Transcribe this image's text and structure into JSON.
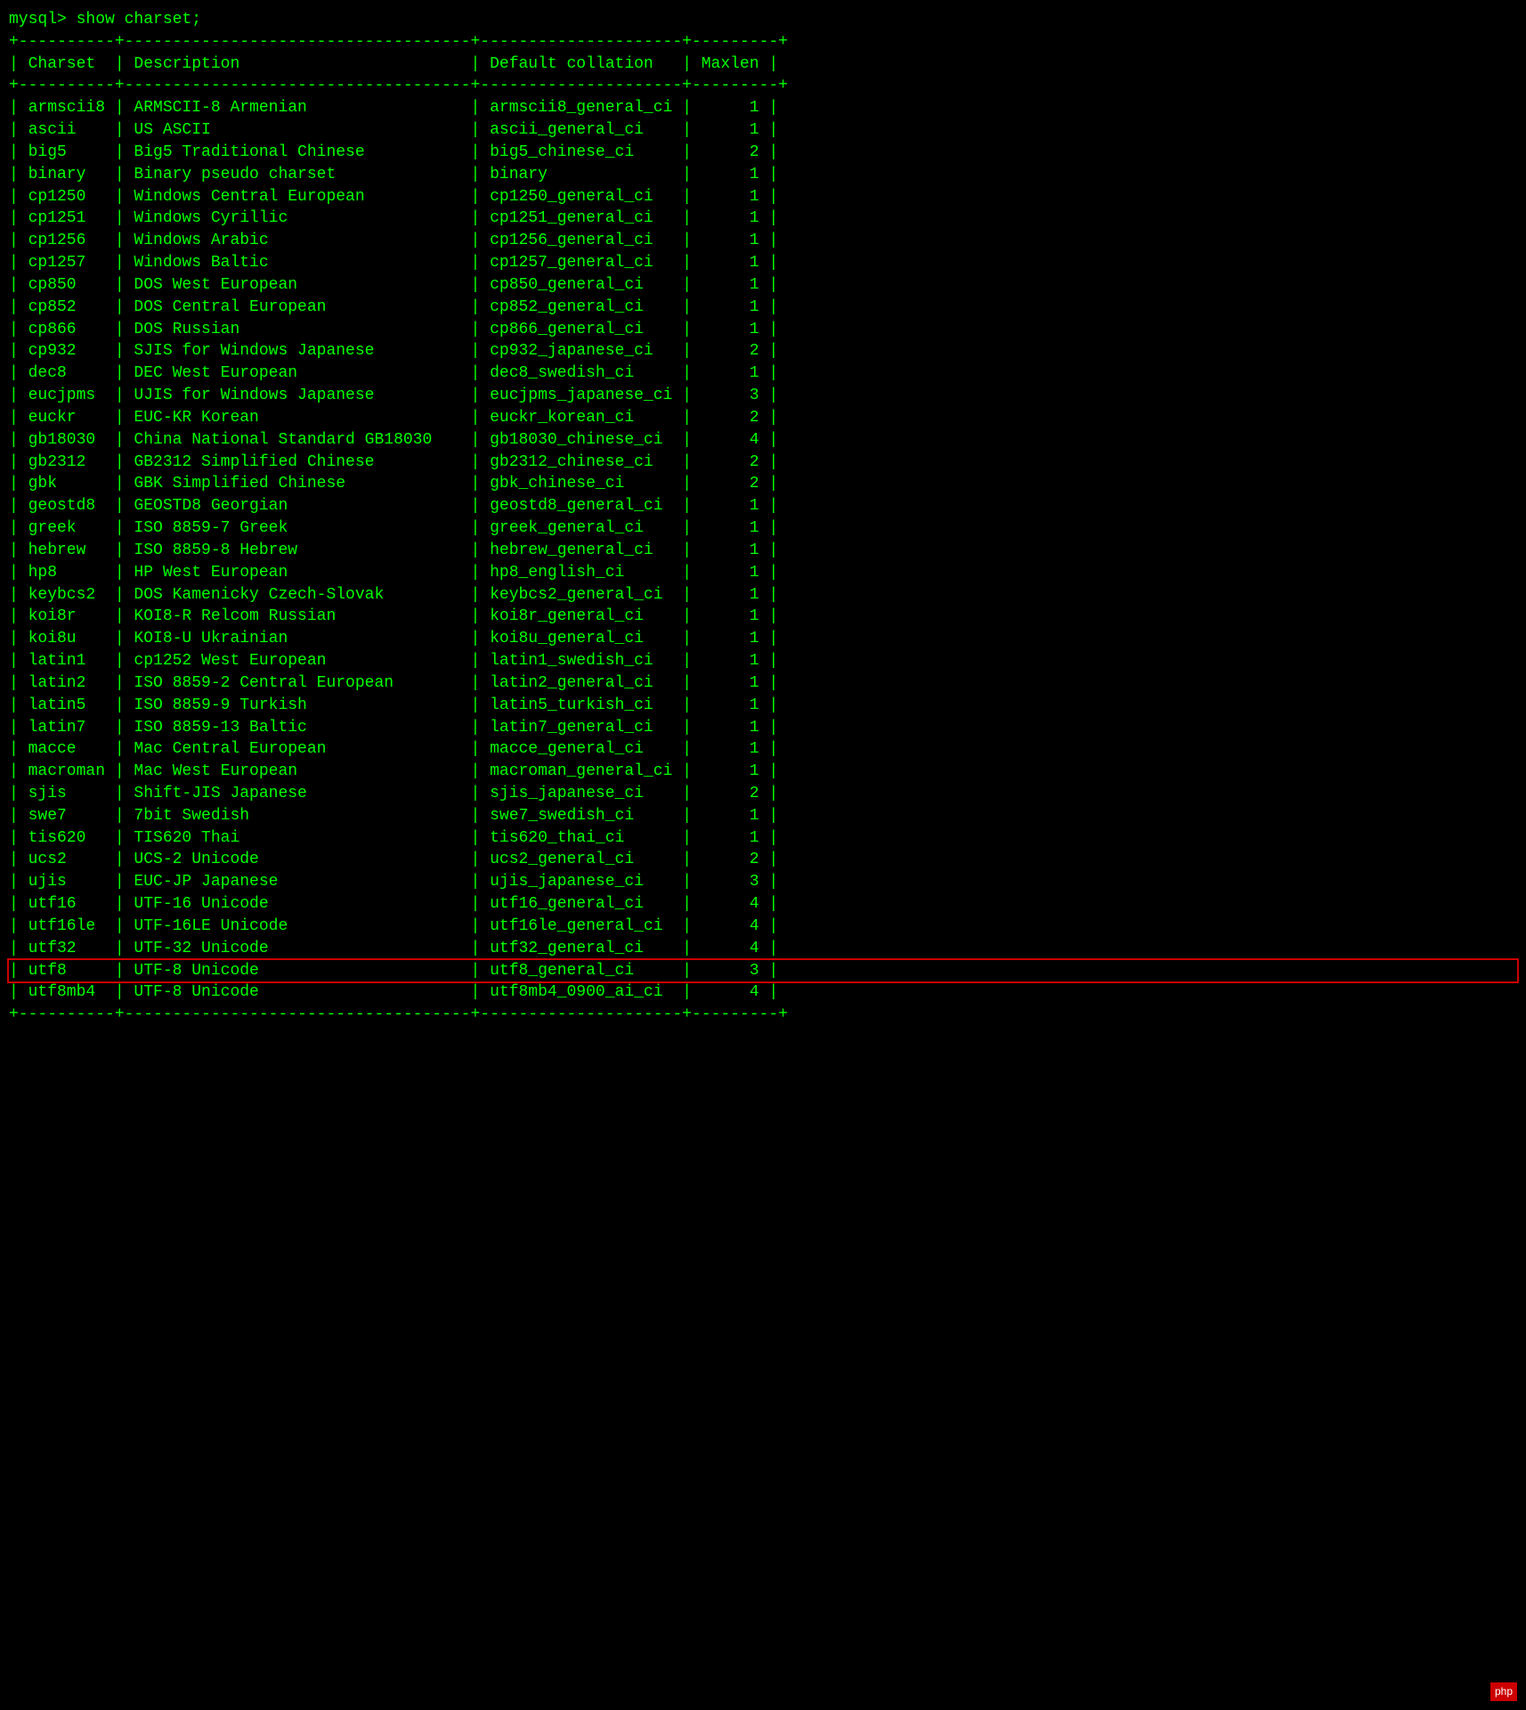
{
  "terminal": {
    "command": "mysql> show charset;",
    "separator_top": "+----------+------------------------------------+---------------------+---------+",
    "separator_head": "+----------+------------------------------------+---------------------+---------+",
    "separator_row": "+----------+------------------------------------+---------------------+---------+",
    "header": {
      "charset": "Charset",
      "description": "Description",
      "collation": "Default collation",
      "maxlen": "Maxlen"
    },
    "rows": [
      {
        "charset": "armscii8",
        "description": "ARMSCII-8 Armenian",
        "collation": "armscii8_general_ci",
        "maxlen": "1"
      },
      {
        "charset": "ascii",
        "description": "US ASCII",
        "collation": "ascii_general_ci",
        "maxlen": "1"
      },
      {
        "charset": "big5",
        "description": "Big5 Traditional Chinese",
        "collation": "big5_chinese_ci",
        "maxlen": "2"
      },
      {
        "charset": "binary",
        "description": "Binary pseudo charset",
        "collation": "binary",
        "maxlen": "1"
      },
      {
        "charset": "cp1250",
        "description": "Windows Central European",
        "collation": "cp1250_general_ci",
        "maxlen": "1"
      },
      {
        "charset": "cp1251",
        "description": "Windows Cyrillic",
        "collation": "cp1251_general_ci",
        "maxlen": "1"
      },
      {
        "charset": "cp1256",
        "description": "Windows Arabic",
        "collation": "cp1256_general_ci",
        "maxlen": "1"
      },
      {
        "charset": "cp1257",
        "description": "Windows Baltic",
        "collation": "cp1257_general_ci",
        "maxlen": "1"
      },
      {
        "charset": "cp850",
        "description": "DOS West European",
        "collation": "cp850_general_ci",
        "maxlen": "1"
      },
      {
        "charset": "cp852",
        "description": "DOS Central European",
        "collation": "cp852_general_ci",
        "maxlen": "1"
      },
      {
        "charset": "cp866",
        "description": "DOS Russian",
        "collation": "cp866_general_ci",
        "maxlen": "1"
      },
      {
        "charset": "cp932",
        "description": "SJIS for Windows Japanese",
        "collation": "cp932_japanese_ci",
        "maxlen": "2"
      },
      {
        "charset": "dec8",
        "description": "DEC West European",
        "collation": "dec8_swedish_ci",
        "maxlen": "1"
      },
      {
        "charset": "eucjpms",
        "description": "UJIS for Windows Japanese",
        "collation": "eucjpms_japanese_ci",
        "maxlen": "3"
      },
      {
        "charset": "euckr",
        "description": "EUC-KR Korean",
        "collation": "euckr_korean_ci",
        "maxlen": "2"
      },
      {
        "charset": "gb18030",
        "description": "China National Standard GB18030",
        "collation": "gb18030_chinese_ci",
        "maxlen": "4"
      },
      {
        "charset": "gb2312",
        "description": "GB2312 Simplified Chinese",
        "collation": "gb2312_chinese_ci",
        "maxlen": "2"
      },
      {
        "charset": "gbk",
        "description": "GBK Simplified Chinese",
        "collation": "gbk_chinese_ci",
        "maxlen": "2"
      },
      {
        "charset": "geostd8",
        "description": "GEOSTD8 Georgian",
        "collation": "geostd8_general_ci",
        "maxlen": "1"
      },
      {
        "charset": "greek",
        "description": "ISO 8859-7 Greek",
        "collation": "greek_general_ci",
        "maxlen": "1"
      },
      {
        "charset": "hebrew",
        "description": "ISO 8859-8 Hebrew",
        "collation": "hebrew_general_ci",
        "maxlen": "1"
      },
      {
        "charset": "hp8",
        "description": "HP West European",
        "collation": "hp8_english_ci",
        "maxlen": "1"
      },
      {
        "charset": "keybcs2",
        "description": "DOS Kamenicky Czech-Slovak",
        "collation": "keybcs2_general_ci",
        "maxlen": "1"
      },
      {
        "charset": "koi8r",
        "description": "KOI8-R Relcom Russian",
        "collation": "koi8r_general_ci",
        "maxlen": "1"
      },
      {
        "charset": "koi8u",
        "description": "KOI8-U Ukrainian",
        "collation": "koi8u_general_ci",
        "maxlen": "1"
      },
      {
        "charset": "latin1",
        "description": "cp1252 West European",
        "collation": "latin1_swedish_ci",
        "maxlen": "1"
      },
      {
        "charset": "latin2",
        "description": "ISO 8859-2 Central European",
        "collation": "latin2_general_ci",
        "maxlen": "1"
      },
      {
        "charset": "latin5",
        "description": "ISO 8859-9 Turkish",
        "collation": "latin5_turkish_ci",
        "maxlen": "1"
      },
      {
        "charset": "latin7",
        "description": "ISO 8859-13 Baltic",
        "collation": "latin7_general_ci",
        "maxlen": "1"
      },
      {
        "charset": "macce",
        "description": "Mac Central European",
        "collation": "macce_general_ci",
        "maxlen": "1"
      },
      {
        "charset": "macroman",
        "description": "Mac West European",
        "collation": "macroman_general_ci",
        "maxlen": "1"
      },
      {
        "charset": "sjis",
        "description": "Shift-JIS Japanese",
        "collation": "sjis_japanese_ci",
        "maxlen": "2"
      },
      {
        "charset": "swe7",
        "description": "7bit Swedish",
        "collation": "swe7_swedish_ci",
        "maxlen": "1"
      },
      {
        "charset": "tis620",
        "description": "TIS620 Thai",
        "collation": "tis620_thai_ci",
        "maxlen": "1"
      },
      {
        "charset": "ucs2",
        "description": "UCS-2 Unicode",
        "collation": "ucs2_general_ci",
        "maxlen": "2"
      },
      {
        "charset": "ujis",
        "description": "EUC-JP Japanese",
        "collation": "ujis_japanese_ci",
        "maxlen": "3"
      },
      {
        "charset": "utf16",
        "description": "UTF-16 Unicode",
        "collation": "utf16_general_ci",
        "maxlen": "4"
      },
      {
        "charset": "utf16le",
        "description": "UTF-16LE Unicode",
        "collation": "utf16le_general_ci",
        "maxlen": "4"
      },
      {
        "charset": "utf32",
        "description": "UTF-32 Unicode",
        "collation": "utf32_general_ci",
        "maxlen": "4"
      },
      {
        "charset": "utf8",
        "description": "UTF-8 Unicode",
        "collation": "utf8_general_ci",
        "maxlen": "3",
        "highlighted": true
      },
      {
        "charset": "utf8mb4",
        "description": "UTF-8 Unicode",
        "collation": "utf8mb4_0900_ai_ci",
        "maxlen": "4"
      }
    ]
  }
}
